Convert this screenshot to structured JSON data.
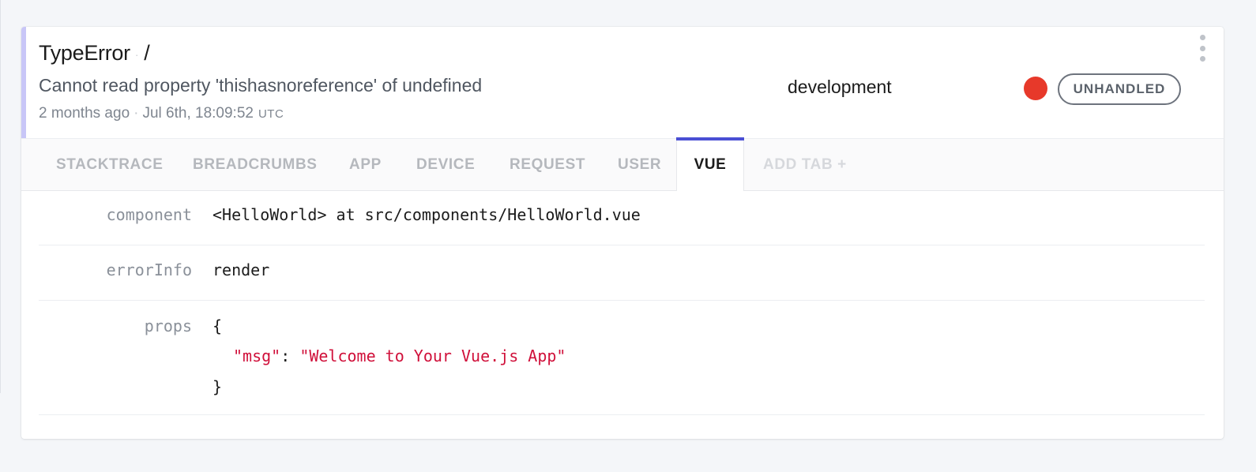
{
  "error": {
    "type": "TypeError",
    "context": "/",
    "message": "Cannot read property 'thishasnoreference' of undefined",
    "relative_time": "2 months ago",
    "timestamp": "Jul 6th, 18:09:52",
    "timezone": "UTC",
    "environment": "development",
    "status_color": "#e7392a",
    "badge": "UNHANDLED",
    "accent_color": "#c8c6f7"
  },
  "tabs": [
    {
      "label": "STACKTRACE",
      "active": false
    },
    {
      "label": "BREADCRUMBS",
      "active": false
    },
    {
      "label": "APP",
      "active": false
    },
    {
      "label": "DEVICE",
      "active": false
    },
    {
      "label": "REQUEST",
      "active": false
    },
    {
      "label": "USER",
      "active": false
    },
    {
      "label": "VUE",
      "active": true
    },
    {
      "label": "ADD TAB +",
      "active": false
    }
  ],
  "active_tab_color": "#4a4fd4",
  "vue": {
    "component": {
      "key": "component",
      "value": "<HelloWorld> at src/components/HelloWorld.vue"
    },
    "errorInfo": {
      "key": "errorInfo",
      "value": "render"
    },
    "props": {
      "key": "props",
      "open": "{",
      "prop_key": "\"msg\"",
      "colon": ": ",
      "prop_value": "\"Welcome to Your Vue.js App\"",
      "close": "}"
    }
  },
  "icons": {
    "menu": "kebab-menu-icon",
    "status": "status-dot"
  }
}
